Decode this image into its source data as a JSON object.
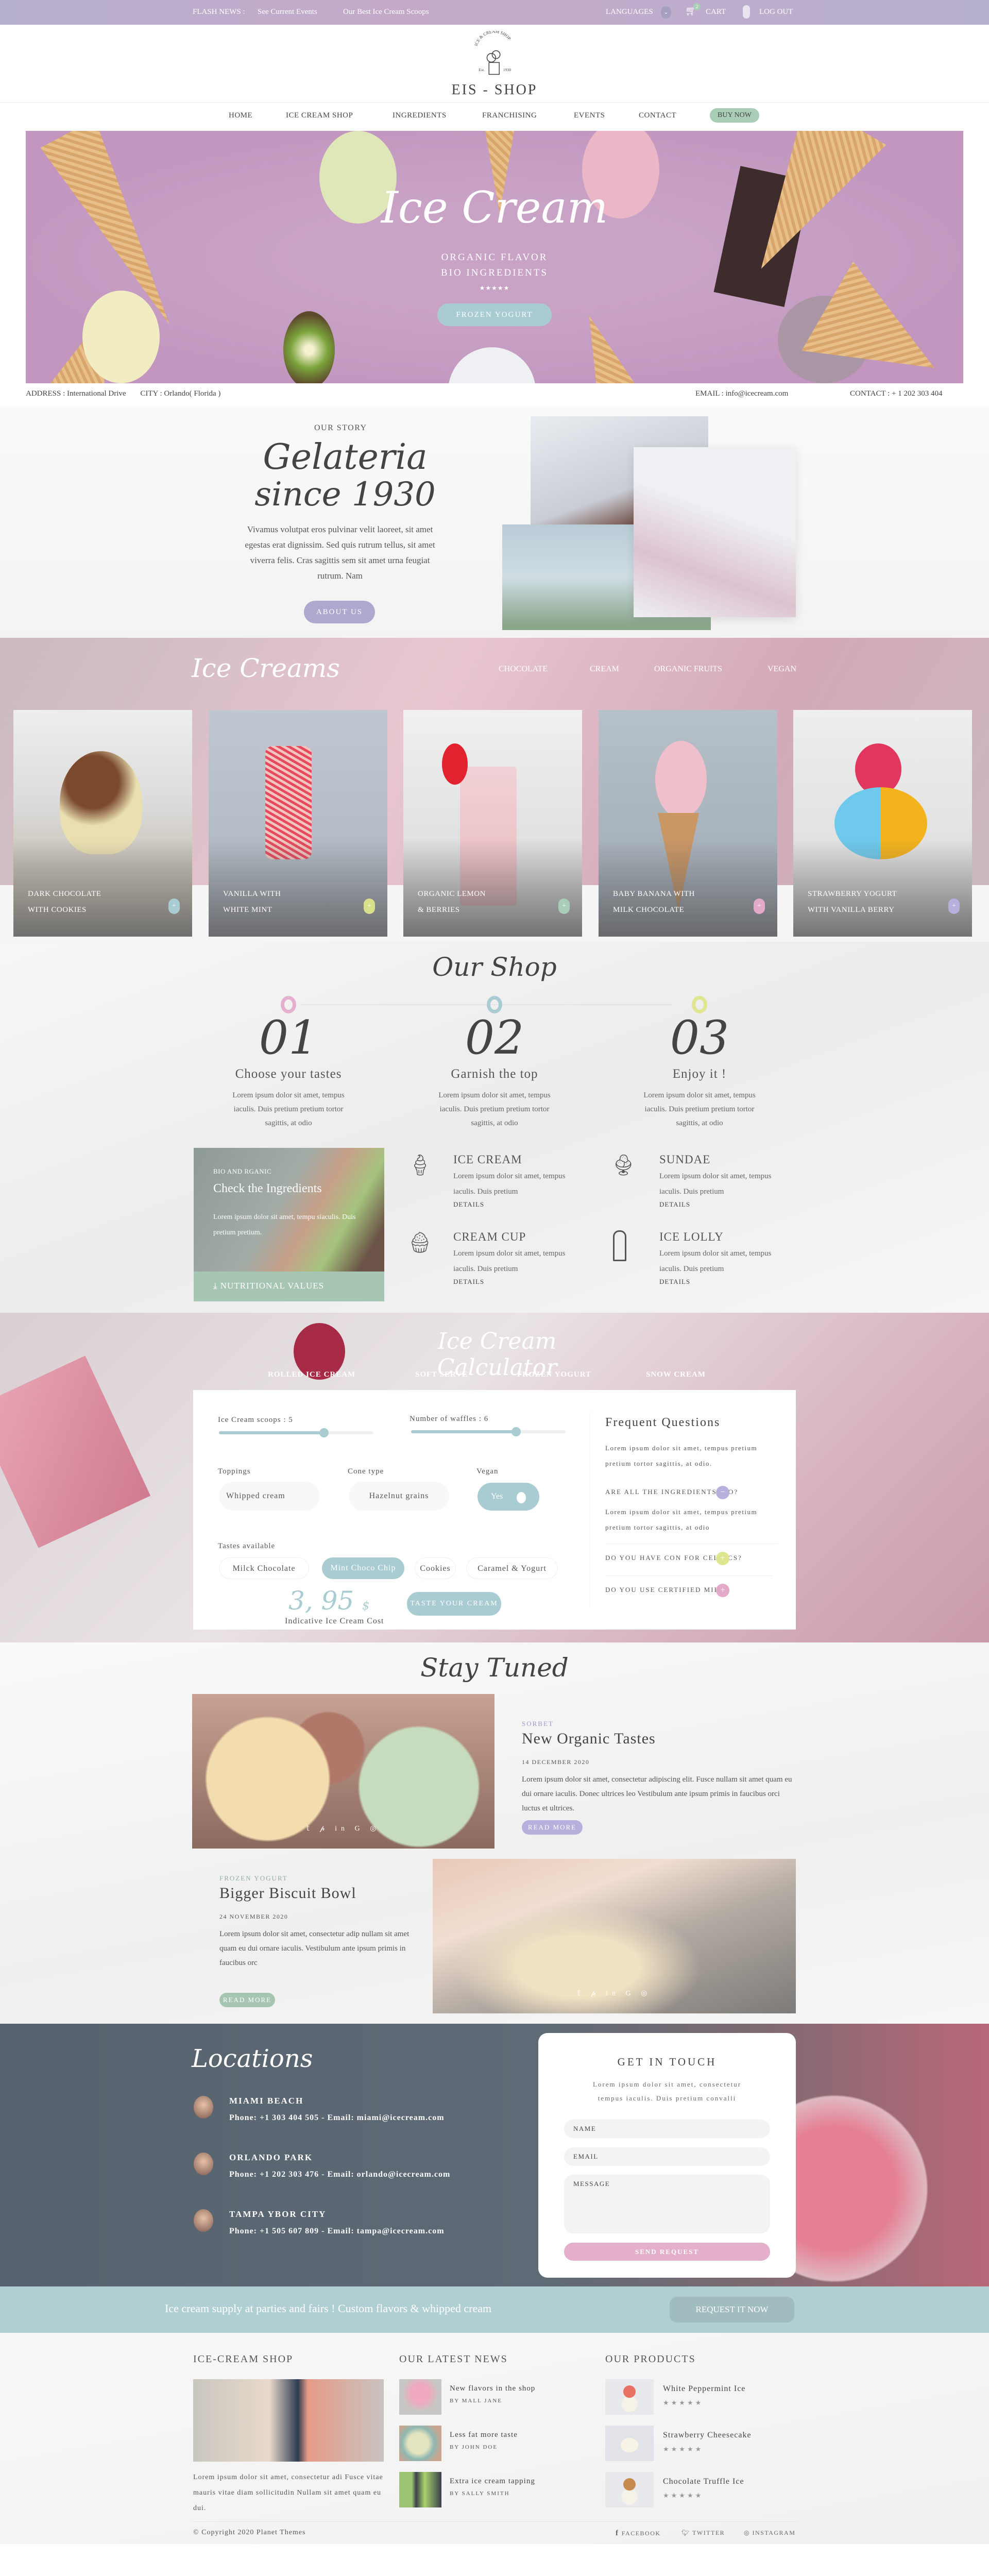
{
  "topbar": {
    "flash_label": "FLASH NEWS :",
    "links": [
      "See Current Events",
      "Our Best Ice Cream Scoops"
    ],
    "languages": "LANGUAGES",
    "cart": "CART",
    "cart_count": "2",
    "logout": "LOG OUT"
  },
  "logo": {
    "arc_text": "ICE & CREAM SHOP",
    "est_left": "Est.",
    "est_right": "1930",
    "name": "EIS - SHOP"
  },
  "nav": {
    "items": [
      "HOME",
      "ICE CREAM SHOP",
      "INGREDIENTS",
      "FRANCHISING",
      "EVENTS",
      "CONTACT"
    ],
    "buy": "BUY NOW"
  },
  "hero": {
    "title": "Ice Cream",
    "line1": "ORGANIC FLAVOR",
    "line2": "BIO INGREDIENTS",
    "stars": "★★★★★",
    "button": "FROZEN YOGURT"
  },
  "address_bar": {
    "address": "ADDRESS : International Drive",
    "city": "CITY : Orlando( Florida )",
    "email": "EMAIL : info@icecream.com",
    "contact": "CONTACT : + 1 202 303 404"
  },
  "story": {
    "eyebrow": "OUR STORY",
    "title1": "Gelateria",
    "title2": "since 1930",
    "text": "Vivamus volutpat eros pulvinar velit laoreet, sit amet egestas erat dignissim. Sed quis rutrum tellus, sit amet viverra felis. Cras sagittis sem sit amet urna feugiat rutrum. Nam",
    "button": "ABOUT US"
  },
  "ice_creams": {
    "title": "Ice Creams",
    "filters": [
      "CHOCOLATE",
      "CREAM",
      "ORGANIC FRUITS",
      "VEGAN"
    ],
    "cards": [
      {
        "l1": "DARK CHOCOLATE",
        "l2": "WITH COOKIES",
        "color": "#a9ccd2"
      },
      {
        "l1": "VANILLA WITH",
        "l2": "WHITE MINT",
        "color": "#d9e08a"
      },
      {
        "l1": "ORGANIC LEMON",
        "l2": "& BERRIES",
        "color": "#a9cdb6"
      },
      {
        "l1": "BABY BANANA WITH",
        "l2": "MILK CHOCOLATE",
        "color": "#e3a9c8"
      },
      {
        "l1": "STRAWBERRY YOGURT",
        "l2": "WITH VANILLA BERRY",
        "color": "#b7b0dd"
      }
    ]
  },
  "shop": {
    "title": "Our Shop",
    "steps": [
      {
        "num": "01",
        "title": "Choose your tastes",
        "text": "Lorem ipsum dolor sit amet, tempus iaculis. Duis pretium pretium tortor sagittis, at odio",
        "color": "#e5b0cf"
      },
      {
        "num": "02",
        "title": "Garnish the top",
        "text": "Lorem ipsum dolor sit amet, tempus iaculis. Duis pretium pretium tortor sagittis, at odio",
        "color": "#a9ccd2"
      },
      {
        "num": "03",
        "title": "Enjoy it !",
        "text": "Lorem ipsum dolor sit amet, tempus iaculis. Duis pretium pretium tortor sagittis, at odio",
        "color": "#dfe690"
      }
    ],
    "promo": {
      "eyebrow": "BIO AND RGANIC",
      "title": "Check the Ingredients",
      "text": "Lorem ipsum dolor sit amet, tempu siaculis. Duis pretium pretium.",
      "button": "NUTRITIONAL VALUES"
    },
    "features": [
      {
        "title": "ICE CREAM",
        "text": "Lorem ipsum dolor sit amet, tempus iaculis. Duis pretium",
        "link": "DETAILS"
      },
      {
        "title": "SUNDAE",
        "text": "Lorem ipsum dolor sit amet, tempus iaculis. Duis pretium",
        "link": "DETAILS"
      },
      {
        "title": "CREAM CUP",
        "text": "Lorem ipsum dolor sit amet, tempus iaculis. Duis pretium",
        "link": "DETAILS"
      },
      {
        "title": "ICE LOLLY",
        "text": "Lorem ipsum dolor sit amet, tempus iaculis. Duis pretium",
        "link": "DETAILS"
      }
    ]
  },
  "calculator": {
    "title": "Ice Cream Calculator",
    "tabs": [
      "ROLLED ICE CREAM",
      "SOFT SERVE",
      "FROZEN YOGURT",
      "SNOW CREAM"
    ],
    "scoops_label": "Ice Cream scoops  : 5",
    "scoops_fraction": 0.68,
    "waffles_label": "Number of waffles : 6",
    "waffles_fraction": 0.68,
    "toppings_label": "Toppings",
    "toppings_value": "Whipped cream",
    "cone_label": "Cone type",
    "cone_value": "Hazelnut grains",
    "vegan_label": "Vegan",
    "vegan_value": "Yes",
    "tastes_label": "Tastes available",
    "tastes": [
      "Milck Chocolate",
      "Mint Choco Chip",
      "Cookies",
      "Caramel & Yogurt"
    ],
    "selected_taste": 1,
    "price": "3, 95",
    "currency": "$",
    "price_label": "Indicative Ice Cream Cost",
    "button": "TASTE YOUR CREAM",
    "faq": {
      "title": "Frequent Questions",
      "intro": "Lorem ipsum dolor sit amet,  tempus pretium pretium tortor sagittis, at odio.",
      "items": [
        {
          "q": "ARE ALL THE INGREDIENTS BIO?",
          "a": "Lorem ipsum dolor sit amet,  tempus pretium pretium tortor sagittis, at odio",
          "icon": "−",
          "color": "#b7b0dd"
        },
        {
          "q": "DO YOU HAVE CON FOR CELIACS?",
          "icon": "+",
          "color": "#dfe690"
        },
        {
          "q": "DO YOU USE CERTIFIED MILK?",
          "icon": "+",
          "color": "#e3a9c8"
        }
      ]
    }
  },
  "stay_tuned": {
    "title": "Stay Tuned",
    "posts": [
      {
        "category": "SORBET",
        "title": "New Organic Tastes",
        "date": "14 DECEMBER 2020",
        "text": "Lorem ipsum dolor sit amet, consectetur adipiscing elit. Fusce nullam sit amet quam eu dui ornare iaculis. Donec ultrices leo Vestibulum ante ipsum primis in faucibus orci luctus et ultrices.",
        "button": "READ MORE"
      },
      {
        "category": "FROZEN YOGURT",
        "title": "Bigger Biscuit Bowl",
        "date": "24 NOVEMBER 2020",
        "text": "Lorem ipsum dolor sit amet, consectetur adip nullam sit amet quam eu dui ornare iaculis. Vestibulum ante ipsum primis in faucibus orc",
        "button": "READ MORE"
      }
    ],
    "social": "𝕥 𝓅 in G ◎"
  },
  "locations": {
    "title": "Locations",
    "items": [
      {
        "name": "MIAMI BEACH",
        "info": "Phone: +1 303 404 505 - Email: miami@icecream.com"
      },
      {
        "name": "ORLANDO PARK",
        "info": "Phone: +1 202 303 476 - Email: orlando@icecream.com"
      },
      {
        "name": "TAMPA YBOR CITY",
        "info": "Phone: +1 505 607 809 - Email: tampa@icecream.com"
      }
    ],
    "contact": {
      "title": "GET IN TOUCH",
      "text": "Lorem ipsum dolor sit amet, consectetur tempus iaculis. Duis pretium convalli",
      "name_ph": "NAME",
      "email_ph": "EMAIL",
      "message_ph": "MESSAGE",
      "button": "SEND REQUEST"
    }
  },
  "banner": {
    "text": "Ice cream supply at parties and fairs ! Custom flavors & whipped cream",
    "button": "REQUEST IT NOW"
  },
  "footer": {
    "about": {
      "title": "ICE-CREAM SHOP",
      "text": "Lorem ipsum dolor sit amet, consectetur adi Fusce vitae mauris vitae diam sollicitudin Nullam sit amet quam eu dui."
    },
    "news": {
      "title": "OUR LATEST NEWS",
      "items": [
        {
          "title": "New flavors in the shop",
          "by": "BY MALL JANE"
        },
        {
          "title": "Less fat more taste",
          "by": "BY JOHN DOE"
        },
        {
          "title": "Extra ice cream tapping",
          "by": "BY SALLY SMITH"
        }
      ]
    },
    "products": {
      "title": "OUR PRODUCTS",
      "items": [
        {
          "name": "White Peppermint Ice",
          "rating": 5
        },
        {
          "name": "Strawberry Cheesecake",
          "rating": 5
        },
        {
          "name": "Chocolate Truffle Ice",
          "rating": 5
        }
      ]
    },
    "copyright": "© Copyright 2020 Planet Themes",
    "social": [
      "FACEBOOK",
      "TWITTER",
      "INSTAGRAM"
    ]
  }
}
